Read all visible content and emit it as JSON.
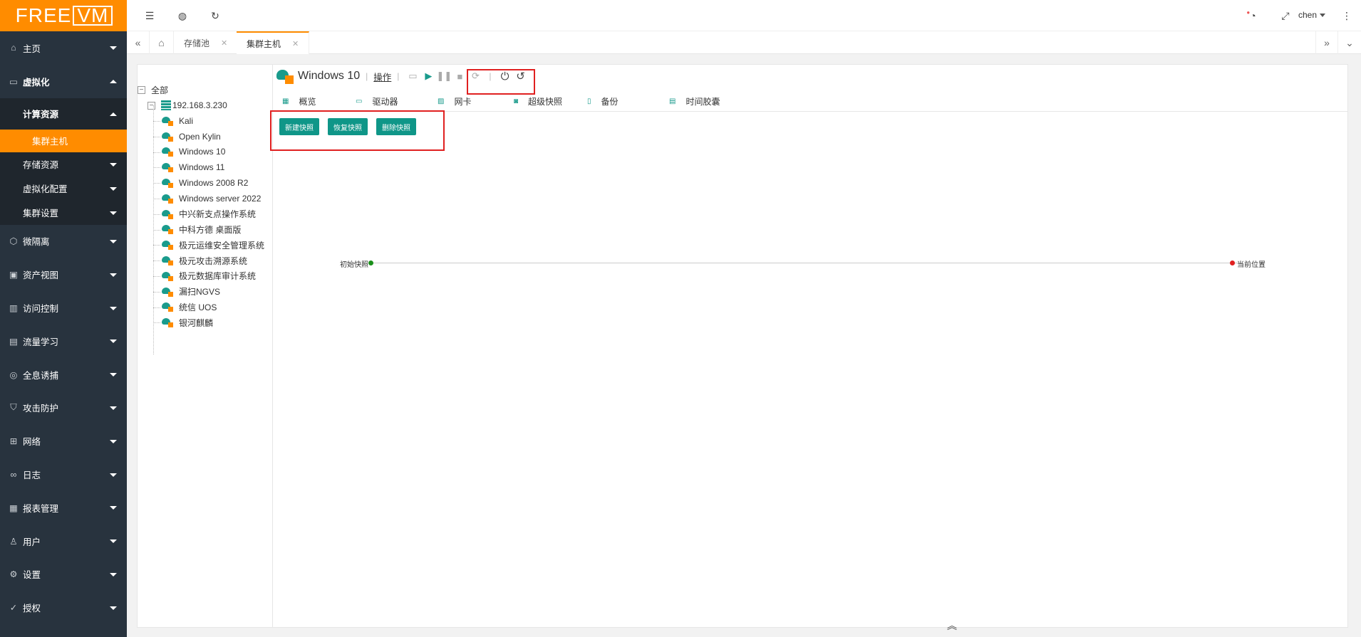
{
  "app": {
    "logo_part1": "FREE",
    "logo_part2": "VM",
    "user": "chen",
    "accent_color": "#ff8c00",
    "primary_color": "#0f9688"
  },
  "sidebar": {
    "top_items": [
      {
        "label": "主页",
        "icon": "home-icon"
      },
      {
        "label": "虚拟化",
        "icon": "virtualization-icon"
      }
    ],
    "sub_header": "计算资源",
    "sub_active": "集群主机",
    "sub_items": [
      {
        "label": "存储资源"
      },
      {
        "label": "虚拟化配置"
      },
      {
        "label": "集群设置"
      }
    ],
    "items": [
      {
        "label": "微隔离",
        "icon": "cube-icon"
      },
      {
        "label": "资产视图",
        "icon": "asset-icon"
      },
      {
        "label": "访问控制",
        "icon": "access-icon"
      },
      {
        "label": "流量学习",
        "icon": "traffic-icon"
      },
      {
        "label": "全息诱捕",
        "icon": "trap-icon"
      },
      {
        "label": "攻击防护",
        "icon": "shield-icon"
      },
      {
        "label": "网络",
        "icon": "network-icon"
      },
      {
        "label": "日志",
        "icon": "log-icon"
      },
      {
        "label": "报表管理",
        "icon": "report-icon"
      },
      {
        "label": "用户",
        "icon": "user-icon"
      },
      {
        "label": "设置",
        "icon": "gear-icon"
      },
      {
        "label": "授权",
        "icon": "license-icon"
      }
    ]
  },
  "tabs": [
    {
      "label": "存储池"
    },
    {
      "label": "集群主机"
    }
  ],
  "tree": {
    "root": "全部",
    "host": "192.168.3.230",
    "vms": [
      "Kali",
      "Open Kylin",
      "Windows 10",
      "Windows 11",
      "Windows 2008 R2",
      "Windows server 2022",
      "中兴新支点操作系统",
      "中科方德 桌面版",
      "极元运维安全管理系统",
      "极元攻击溯源系统",
      "极元数据库审计系统",
      "漏扫NGVS",
      "统信 UOS",
      "银河麒麟"
    ]
  },
  "vm": {
    "title": "Windows 10",
    "op_label": "操作"
  },
  "subtabs": [
    {
      "label": "概览"
    },
    {
      "label": "驱动器"
    },
    {
      "label": "网卡"
    },
    {
      "label": "超级快照"
    },
    {
      "label": "备份"
    },
    {
      "label": "时间胶囊"
    }
  ],
  "buttons": {
    "new_snapshot": "新建快照",
    "restore_snapshot": "恢复快照",
    "delete_snapshot": "删除快照"
  },
  "timeline": {
    "start_label": "初始快照",
    "end_label": "当前位置",
    "start_color": "#1a8f1a",
    "end_color": "#e02020"
  }
}
